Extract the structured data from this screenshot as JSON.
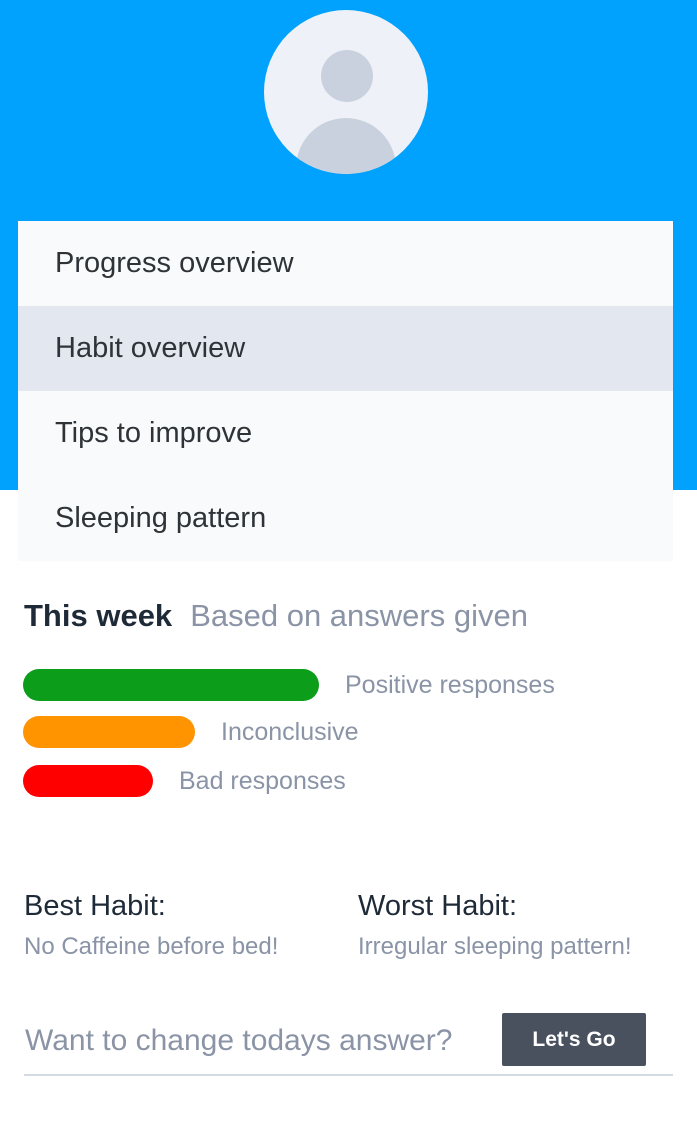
{
  "header": {
    "avatar_icon": "user-avatar-icon",
    "background": "#01a2fe"
  },
  "menu": {
    "items": [
      {
        "label": "Progress overview",
        "active": false
      },
      {
        "label": "Habit overview",
        "active": true
      },
      {
        "label": "Tips to improve",
        "active": false
      },
      {
        "label": "Sleeping pattern",
        "active": false
      }
    ]
  },
  "week": {
    "title": "This week",
    "subtitle": "Based on answers given",
    "bars": [
      {
        "label": "Positive responses",
        "color": "#0c9d1a",
        "value": 1.0
      },
      {
        "label": "Inconclusive",
        "color": "#ff9300",
        "value": 0.58
      },
      {
        "label": "Bad responses",
        "color": "#ff0000",
        "value": 0.44
      }
    ]
  },
  "habits": {
    "best": {
      "title": "Best Habit:",
      "value": "No Caffeine before bed!"
    },
    "worst": {
      "title": "Worst Habit:",
      "value": "Irregular sleeping pattern!"
    }
  },
  "change": {
    "question": "Want to change todays answer?",
    "button_label": "Let's Go"
  }
}
